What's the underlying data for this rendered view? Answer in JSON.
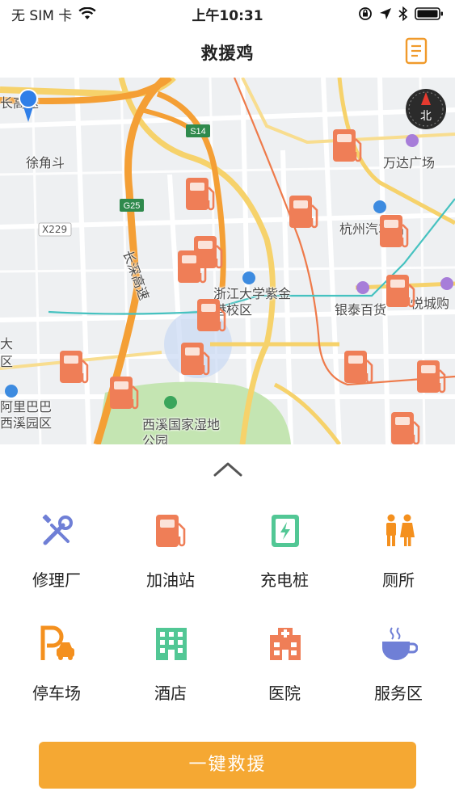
{
  "status_bar": {
    "carrier": "无 SIM 卡",
    "time": "上午10:31"
  },
  "nav": {
    "title": "救援鸡"
  },
  "map": {
    "labels": {
      "road_changsu": "长高速",
      "xujiao": "徐角斗",
      "s14": "S14",
      "g25": "G25",
      "x229": "X229",
      "changshen_highway": "长深高速",
      "wanda": "万达广场",
      "hangzhou_station": "杭州汽车站",
      "zju": "浙江大学紫金港校区",
      "yintai": "银泰百货",
      "yuecheng": "悦城购",
      "da": "大",
      "qu": "区",
      "alibaba": "阿里巴巴西溪园区",
      "xixi": "西溪国家湿地公园"
    },
    "compass_label": "北"
  },
  "categories": [
    {
      "label": "修理厂",
      "icon": "wrench-screwdriver-icon"
    },
    {
      "label": "加油站",
      "icon": "gas-station-icon"
    },
    {
      "label": "充电桩",
      "icon": "charging-station-icon"
    },
    {
      "label": "厕所",
      "icon": "restroom-icon"
    },
    {
      "label": "停车场",
      "icon": "parking-icon"
    },
    {
      "label": "酒店",
      "icon": "hotel-icon"
    },
    {
      "label": "医院",
      "icon": "hospital-icon"
    },
    {
      "label": "服务区",
      "icon": "service-area-icon"
    }
  ],
  "colors": {
    "accent": "#f5a833",
    "poi_orange": "#ef7e57",
    "repair_blue": "#6f7fd6",
    "charge_green": "#52c795",
    "restroom_orange": "#f4901e",
    "hotel_green": "#52c795",
    "hospital_orange": "#ef7e57",
    "service_blue": "#6f7fd6"
  },
  "actions": {
    "rescue": "一键救援"
  }
}
